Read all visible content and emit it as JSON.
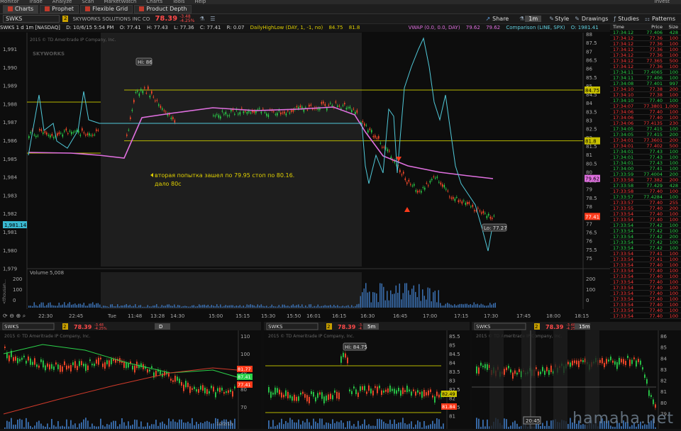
{
  "menubar": {
    "items": [
      "Monitor",
      "Trade",
      "Analyze",
      "Scan",
      "MarketWatch",
      "Charts",
      "Tools",
      "Help"
    ],
    "right": "Invest"
  },
  "tabs": [
    "Charts",
    "Prophet",
    "Flexible Grid",
    "Product Depth"
  ],
  "toolbar": {
    "symbol": "SWKS",
    "badge": "2",
    "desc": "SKYWORKS SOLUTIONS INC COM",
    "price": "78.39",
    "chg1": "-3.48",
    "chg2": "-4.25%",
    "share": "Share",
    "period": "1m",
    "style": "Style",
    "drawings": "Drawings",
    "studies": "Studies",
    "patterns": "Patterns"
  },
  "studybar": {
    "title": "SWKS 1 d 1m [NASDAQ]",
    "date": "D: 10/6/15 5:54 PM",
    "o": "O: 77.41",
    "h": "H: 77.43",
    "l": "L: 77.36",
    "c": "C: 77.41",
    "r": "R: 0.07",
    "dhl": "DailyHighLow (DAY, 1, -1, no)",
    "dhl1": "84.75",
    "dhl2": "81.8",
    "vwap": "VWAP (0.0, 0.0, DAY)",
    "vwap1": "79.62",
    "vwap2": "79.62",
    "comp": "Comparison (LINE, SPX)",
    "comp1": "O: 1981.41"
  },
  "main": {
    "copyright": "2015 © TD Ameritrade IP Company, Inc.",
    "hi_label": "Hi: 86",
    "lo_label": "Lo: 77.27",
    "annotation1": "вторая попытка зашел по 79.95 стоп по 80.16.",
    "annotation2": "дало 80с",
    "spx_badge": "1,981.14",
    "volume_label": "Volume",
    "volume_val": "5,008",
    "thousands": "<thousan..."
  },
  "left_axis": [
    "1,991",
    "1,990",
    "1,989",
    "1,988",
    "1,987",
    "1,986",
    "1,985",
    "1,984",
    "1,983",
    "1,982",
    "1,981",
    "1,980",
    "1,979"
  ],
  "right_axis": [
    "88",
    "87.5",
    "87",
    "86.5",
    "86",
    "85.5",
    "85",
    "84.5",
    "84",
    "83.5",
    "83",
    "82.5",
    "82",
    "81.5",
    "81",
    "80.5",
    "80",
    "79.5",
    "79",
    "78.5",
    "78",
    "77.5",
    "77",
    "76.5",
    "76",
    "75.5",
    "75"
  ],
  "right_badges": {
    "dhl_hi": "84.75",
    "dhl_lo": "81.8",
    "vwap": "79.62",
    "last": "77.41"
  },
  "vol_axis": [
    "200",
    "100",
    "0"
  ],
  "time_axis": [
    "22:30",
    "22:45",
    "Tue",
    "11:48",
    "13:28",
    "14:30",
    "15:00",
    "15:15",
    "15:30",
    "15:50",
    "16:01",
    "16:15",
    "16:30",
    "16:45",
    "17:00",
    "17:15",
    "17:30",
    "17:45",
    "18:00",
    "18:15"
  ],
  "tns": {
    "headers": [
      "Time",
      "Price",
      "Size"
    ],
    "rows": [
      [
        "17:34:12",
        "77.406",
        "428",
        "u"
      ],
      [
        "17:34:12",
        "77.36",
        "100",
        "d"
      ],
      [
        "17:34:12",
        "77.36",
        "100",
        "d"
      ],
      [
        "17:34:12",
        "77.36",
        "100",
        "d"
      ],
      [
        "17:34:12",
        "77.36",
        "100",
        "d"
      ],
      [
        "17:34:12",
        "77.365",
        "500",
        "d"
      ],
      [
        "17:34:12",
        "77.36",
        "100",
        "d"
      ],
      [
        "17:34:11",
        "77.4065",
        "100",
        "u"
      ],
      [
        "17:34:11",
        "77.406",
        "100",
        "u"
      ],
      [
        "17:34:08",
        "77.401",
        "997",
        "u"
      ],
      [
        "17:34:10",
        "77.38",
        "200",
        "d"
      ],
      [
        "17:34:10",
        "77.38",
        "100",
        "d"
      ],
      [
        "17:34:10",
        "77.40",
        "100",
        "u"
      ],
      [
        "17:34:07",
        "77.3801",
        "1,000",
        "d"
      ],
      [
        "17:34:06",
        "77.40",
        "100",
        "d"
      ],
      [
        "17:34:06",
        "77.40",
        "100",
        "d"
      ],
      [
        "17:34:06",
        "77.4135",
        "230",
        "d"
      ],
      [
        "17:34:05",
        "77.415",
        "100",
        "u"
      ],
      [
        "17:34:05",
        "77.415",
        "200",
        "u"
      ],
      [
        "17:34:01",
        "77.3601",
        "200",
        "d"
      ],
      [
        "17:34:01",
        "77.402",
        "500",
        "d"
      ],
      [
        "17:34:01",
        "77.43",
        "100",
        "u"
      ],
      [
        "17:34:01",
        "77.43",
        "100",
        "u"
      ],
      [
        "17:34:01",
        "77.43",
        "100",
        "u"
      ],
      [
        "17:34:00",
        "77.41",
        "100",
        "u"
      ],
      [
        "17:33:59",
        "77.4004",
        "200",
        "u"
      ],
      [
        "17:33:58",
        "77.382",
        "200",
        "d"
      ],
      [
        "17:33:58",
        "77.429",
        "428",
        "u"
      ],
      [
        "17:33:58",
        "77.40",
        "100",
        "d"
      ],
      [
        "17:33:57",
        "77.4284",
        "100",
        "u"
      ],
      [
        "17:33:57",
        "77.40",
        "255",
        "d"
      ],
      [
        "17:33:55",
        "77.40",
        "200",
        "d"
      ],
      [
        "17:33:54",
        "77.40",
        "100",
        "d"
      ],
      [
        "17:33:54",
        "77.40",
        "100",
        "d"
      ],
      [
        "17:33:54",
        "77.42",
        "100",
        "u"
      ],
      [
        "17:33:54",
        "77.42",
        "100",
        "u"
      ],
      [
        "17:33:54",
        "77.42",
        "200",
        "u"
      ],
      [
        "17:33:54",
        "77.42",
        "100",
        "u"
      ],
      [
        "17:33:54",
        "77.42",
        "100",
        "u"
      ],
      [
        "17:33:54",
        "77.41",
        "100",
        "d"
      ],
      [
        "17:33:54",
        "77.41",
        "100",
        "d"
      ],
      [
        "17:33:54",
        "77.40",
        "100",
        "d"
      ],
      [
        "17:33:54",
        "77.40",
        "100",
        "d"
      ],
      [
        "17:33:54",
        "77.40",
        "100",
        "d"
      ],
      [
        "17:33:54",
        "77.40",
        "100",
        "d"
      ],
      [
        "17:33:54",
        "77.40",
        "100",
        "d"
      ],
      [
        "17:33:54",
        "77.40",
        "100",
        "d"
      ],
      [
        "17:33:54",
        "77.40",
        "100",
        "d"
      ],
      [
        "17:33:54",
        "77.40",
        "100",
        "d"
      ],
      [
        "17:33:54",
        "77.40",
        "100",
        "d"
      ],
      [
        "17:33:54",
        "77.40",
        "100",
        "d"
      ]
    ]
  },
  "mini": [
    {
      "symbol": "SWKS",
      "badge": "2",
      "price": "78.39",
      "chg1": "-3.48",
      "chg2": "-4.25%",
      "period": "D",
      "copyright": "2015 © TD Ameritrade IP Company, Inc.",
      "axis": [
        "110",
        "100",
        "90",
        "80",
        "70"
      ],
      "badges": [
        "81.77",
        "87.41",
        "77.41"
      ],
      "date": "10/2/15"
    },
    {
      "symbol": "SWKS",
      "badge": "2",
      "price": "78.39",
      "chg1": "-3.48",
      "chg2": "-4.25%",
      "period": "5m",
      "copyright": "2015 © TD Ameritrade IP Company, Inc.",
      "axis": [
        "85.5",
        "85",
        "84.5",
        "84",
        "83.5",
        "83",
        "82.5",
        "82",
        "81.5",
        "81"
      ],
      "hi": "Hi: 84.75",
      "badges": [
        "82.49",
        "81.84"
      ]
    },
    {
      "symbol": "SWKS",
      "badge": "2",
      "price": "78.39",
      "chg1": "-3.48",
      "chg2": "-4.25%",
      "period": "15m",
      "copyright": "2015 © TD Ameritrade IP Company, Inc.",
      "axis": [
        "86",
        "85",
        "84",
        "83",
        "82",
        "81",
        "80",
        "79"
      ],
      "time": "20:45"
    }
  ],
  "watermark": "hamaha.net"
}
